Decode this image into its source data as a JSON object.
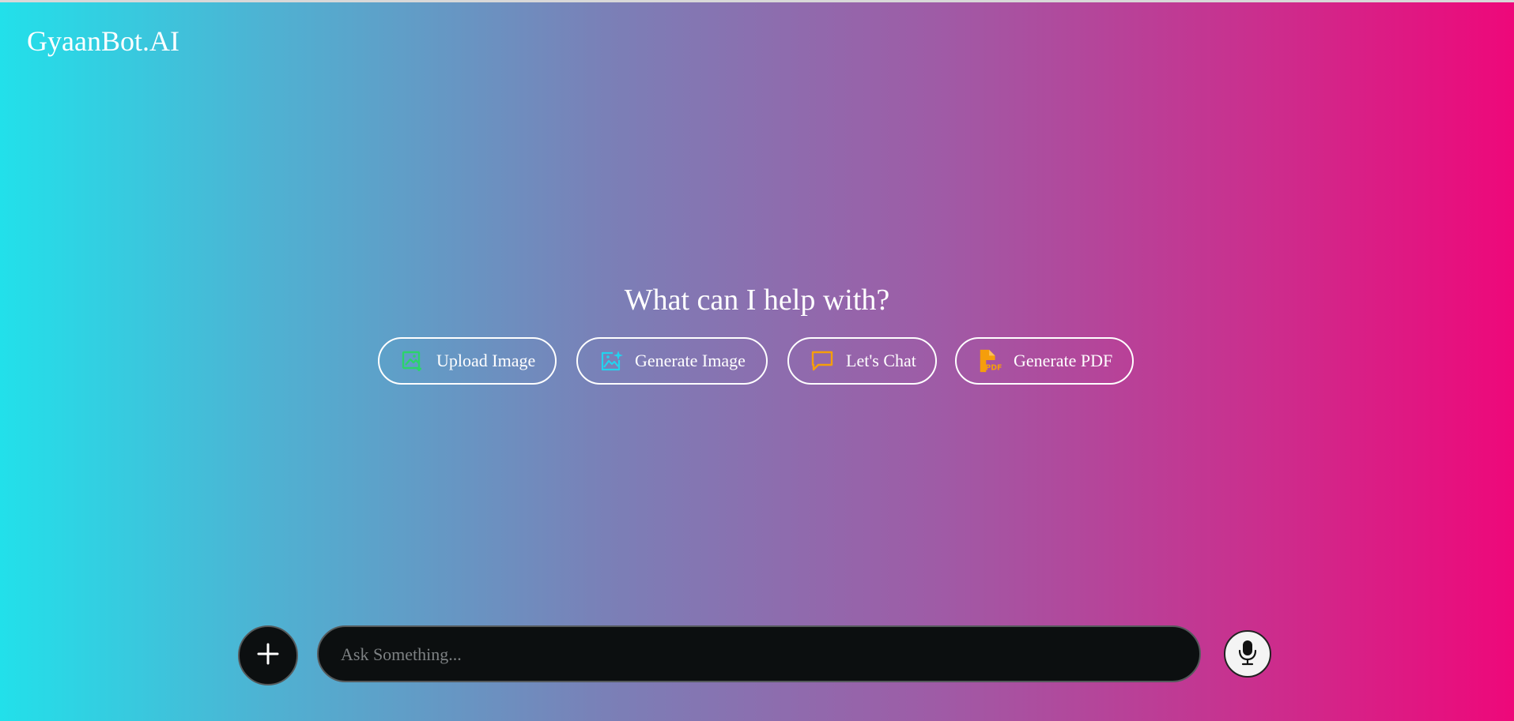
{
  "app": {
    "brand": "GyaanBot.AI"
  },
  "hero": {
    "title": "What can I help with?"
  },
  "actions": [
    {
      "label": "Upload Image",
      "icon": "upload-image-icon",
      "color": "#2bd46a"
    },
    {
      "label": "Generate Image",
      "icon": "generate-image-icon",
      "color": "#22d3ee"
    },
    {
      "label": "Let's Chat",
      "icon": "chat-bubble-icon",
      "color": "#f59e0b"
    },
    {
      "label": "Generate PDF",
      "icon": "pdf-file-icon",
      "color": "#f59e0b"
    }
  ],
  "composer": {
    "placeholder": "Ask Something...",
    "add_icon": "plus-icon",
    "mic_icon": "microphone-icon"
  },
  "colors": {
    "gradient_start": "#22e0ea",
    "gradient_end": "#ee087a",
    "input_bg": "#0c0f10"
  }
}
